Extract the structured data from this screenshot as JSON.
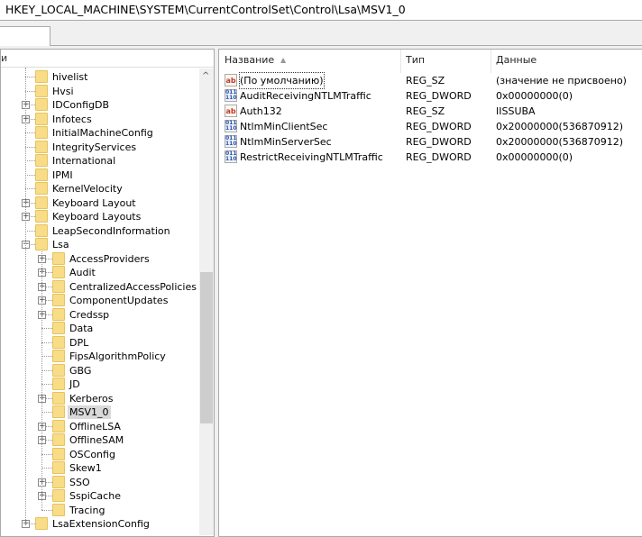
{
  "address": "HKEY_LOCAL_MACHINE\\SYSTEM\\CurrentControlSet\\Control\\Lsa\\MSV1_0",
  "tree_header": "и",
  "tree": [
    {
      "label": "hivelist",
      "level": 1,
      "expander": ""
    },
    {
      "label": "Hvsi",
      "level": 1,
      "expander": ""
    },
    {
      "label": "IDConfigDB",
      "level": 1,
      "expander": "+"
    },
    {
      "label": "Infotecs",
      "level": 1,
      "expander": "+"
    },
    {
      "label": "InitialMachineConfig",
      "level": 1,
      "expander": ""
    },
    {
      "label": "IntegrityServices",
      "level": 1,
      "expander": ""
    },
    {
      "label": "International",
      "level": 1,
      "expander": ""
    },
    {
      "label": "IPMI",
      "level": 1,
      "expander": ""
    },
    {
      "label": "KernelVelocity",
      "level": 1,
      "expander": ""
    },
    {
      "label": "Keyboard Layout",
      "level": 1,
      "expander": "+"
    },
    {
      "label": "Keyboard Layouts",
      "level": 1,
      "expander": "+"
    },
    {
      "label": "LeapSecondInformation",
      "level": 1,
      "expander": ""
    },
    {
      "label": "Lsa",
      "level": 1,
      "expander": "−"
    },
    {
      "label": "AccessProviders",
      "level": 2,
      "expander": "+"
    },
    {
      "label": "Audit",
      "level": 2,
      "expander": "+"
    },
    {
      "label": "CentralizedAccessPolicies",
      "level": 2,
      "expander": "+"
    },
    {
      "label": "ComponentUpdates",
      "level": 2,
      "expander": "+"
    },
    {
      "label": "Credssp",
      "level": 2,
      "expander": "+"
    },
    {
      "label": "Data",
      "level": 2,
      "expander": ""
    },
    {
      "label": "DPL",
      "level": 2,
      "expander": ""
    },
    {
      "label": "FipsAlgorithmPolicy",
      "level": 2,
      "expander": ""
    },
    {
      "label": "GBG",
      "level": 2,
      "expander": ""
    },
    {
      "label": "JD",
      "level": 2,
      "expander": ""
    },
    {
      "label": "Kerberos",
      "level": 2,
      "expander": "+"
    },
    {
      "label": "MSV1_0",
      "level": 2,
      "expander": "",
      "selected": true
    },
    {
      "label": "OfflineLSA",
      "level": 2,
      "expander": "+"
    },
    {
      "label": "OfflineSAM",
      "level": 2,
      "expander": "+"
    },
    {
      "label": "OSConfig",
      "level": 2,
      "expander": ""
    },
    {
      "label": "Skew1",
      "level": 2,
      "expander": ""
    },
    {
      "label": "SSO",
      "level": 2,
      "expander": "+"
    },
    {
      "label": "SspiCache",
      "level": 2,
      "expander": "+"
    },
    {
      "label": "Tracing",
      "level": 2,
      "expander": ""
    },
    {
      "label": "LsaExtensionConfig",
      "level": 1,
      "expander": "+"
    }
  ],
  "columns": {
    "name": "Название",
    "type": "Тип",
    "data": "Данные"
  },
  "values": [
    {
      "icon": "ab",
      "name": "(По умолчанию)",
      "type": "REG_SZ",
      "data": "(значение не присвоено)"
    },
    {
      "icon": "bin",
      "name": "AuditReceivingNTLMTraffic",
      "type": "REG_DWORD",
      "data": "0x00000000(0)"
    },
    {
      "icon": "ab",
      "name": "Auth132",
      "type": "REG_SZ",
      "data": "IISSUBA"
    },
    {
      "icon": "bin",
      "name": "NtlmMinClientSec",
      "type": "REG_DWORD",
      "data": "0x20000000(536870912)"
    },
    {
      "icon": "bin",
      "name": "NtlmMinServerSec",
      "type": "REG_DWORD",
      "data": "0x20000000(536870912)"
    },
    {
      "icon": "bin",
      "name": "RestrictReceivingNTLMTraffic",
      "type": "REG_DWORD",
      "data": "0x00000000(0)"
    }
  ]
}
